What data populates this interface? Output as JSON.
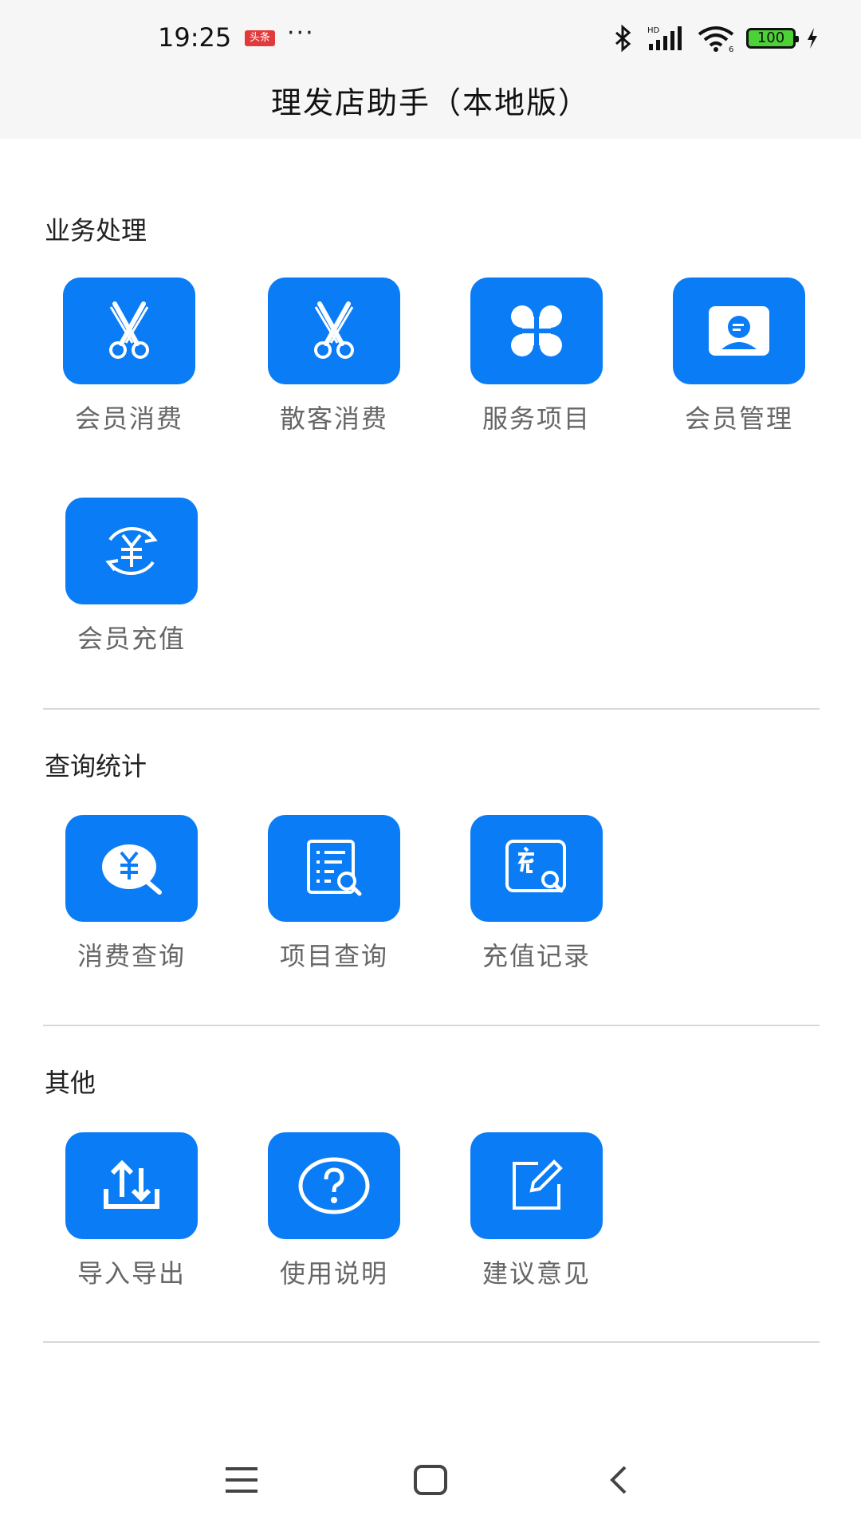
{
  "status_bar": {
    "time": "19:25",
    "badge": "头条",
    "dots": "···",
    "battery": "100"
  },
  "header": {
    "title": "理发店助手（本地版）"
  },
  "sections": [
    {
      "title": "业务处理",
      "items": [
        {
          "label": "会员消费",
          "icon": "scissors-icon"
        },
        {
          "label": "散客消费",
          "icon": "scissors-icon"
        },
        {
          "label": "服务项目",
          "icon": "clover-icon"
        },
        {
          "label": "会员管理",
          "icon": "member-card-icon"
        },
        {
          "label": "会员充值",
          "icon": "yuan-refresh-icon"
        }
      ]
    },
    {
      "title": "查询统计",
      "items": [
        {
          "label": "消费查询",
          "icon": "yuan-search-icon"
        },
        {
          "label": "项目查询",
          "icon": "list-search-icon"
        },
        {
          "label": "充值记录",
          "icon": "recharge-search-icon"
        }
      ]
    },
    {
      "title": "其他",
      "items": [
        {
          "label": "导入导出",
          "icon": "import-export-icon"
        },
        {
          "label": "使用说明",
          "icon": "help-icon"
        },
        {
          "label": "建议意见",
          "icon": "edit-icon"
        }
      ]
    }
  ],
  "colors": {
    "accent": "#0a7cf6",
    "topbar_bg": "#f6f6f6",
    "label": "#666666"
  },
  "navbar": {
    "icons": [
      "menu-icon",
      "home-icon",
      "back-icon"
    ]
  }
}
